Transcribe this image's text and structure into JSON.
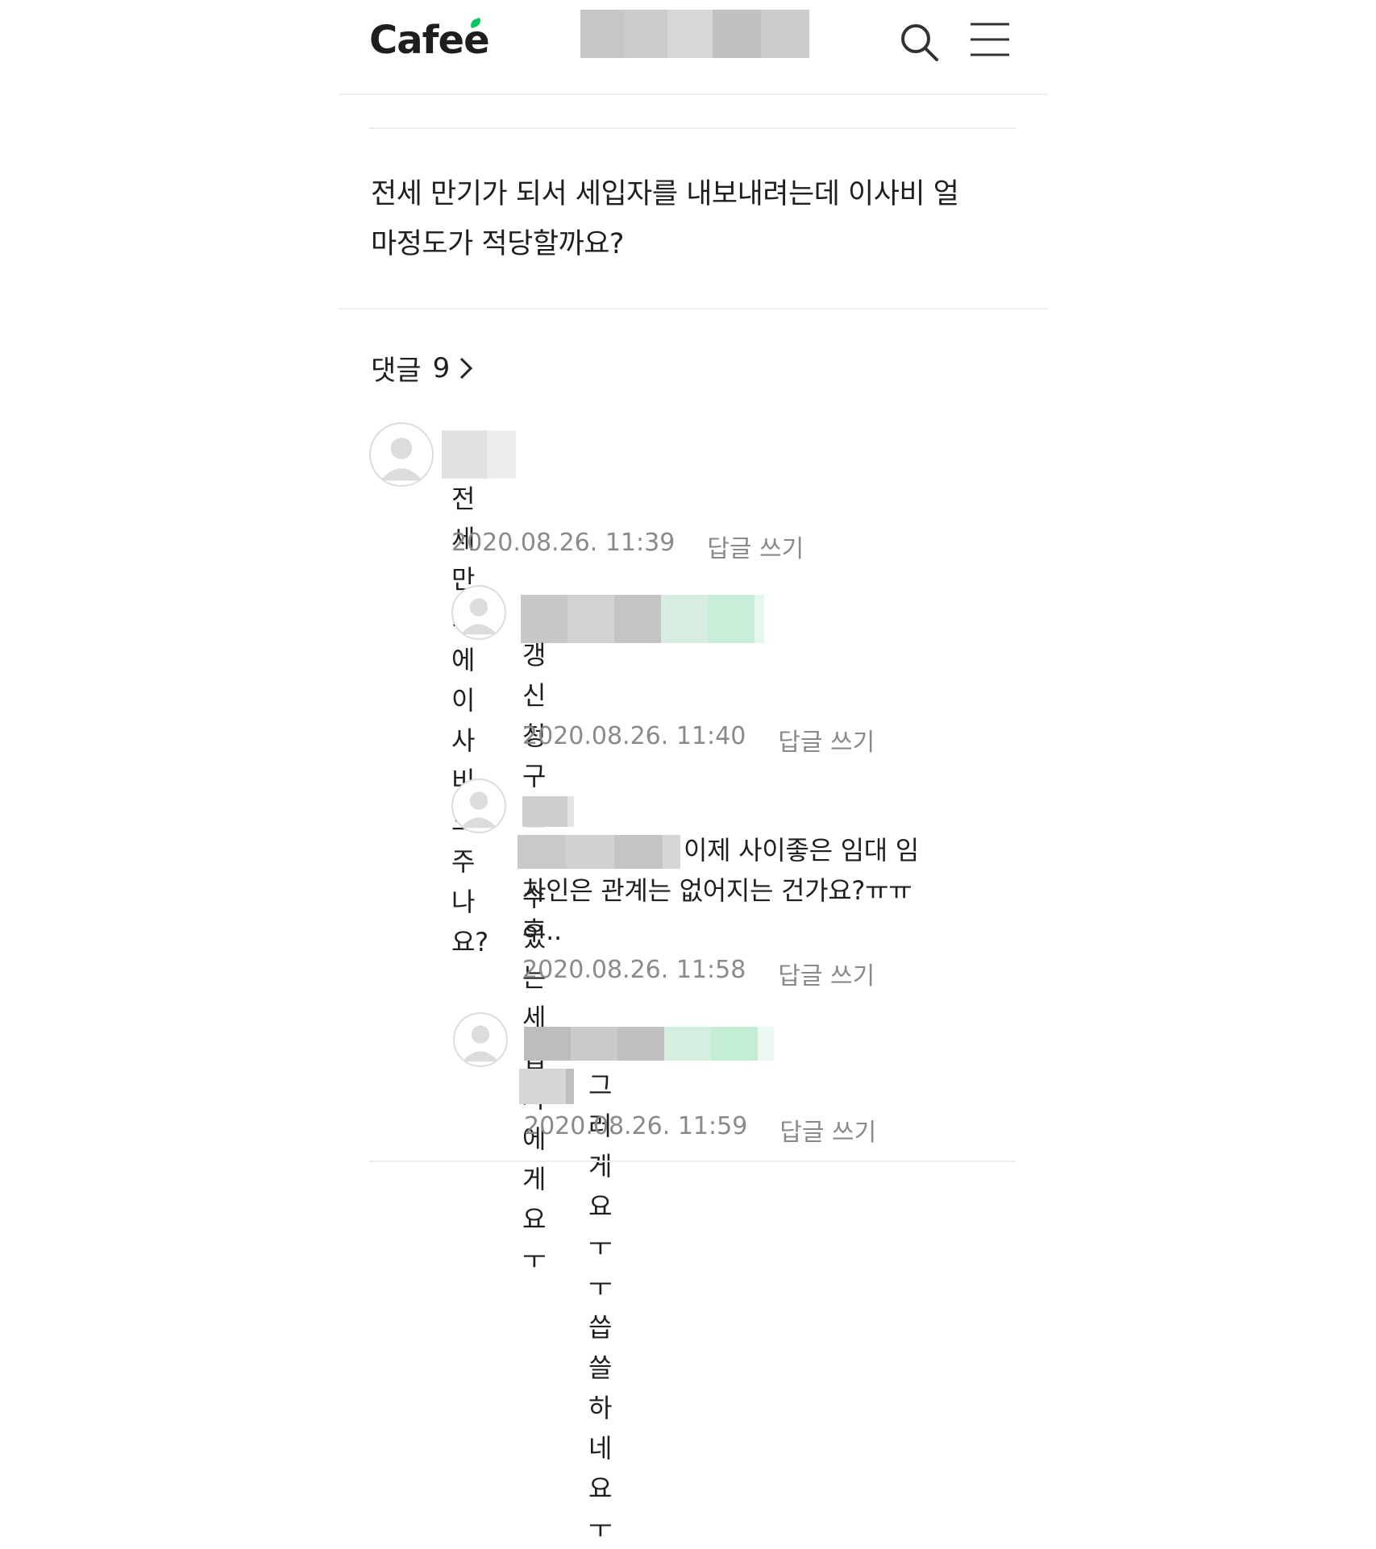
{
  "header": {
    "logo_text": "Cafe",
    "logo_accent": "é",
    "icons": [
      "search-icon",
      "menu-icon"
    ]
  },
  "colors": {
    "brand": "#03c75a",
    "blur_gray_1": "#c4c4c4",
    "blur_gray_2": "#d4d4d4",
    "blur_gray_3": "#bdbdbd",
    "blur_green": "#cdeedd",
    "meta_gray": "#8a8a8a"
  },
  "post": {
    "title_line1": "전세 만기가 되서 세입자를 내보내려는데 이사비 얼",
    "title_line2": "마정도가 적당할까요?"
  },
  "comments_header": {
    "label": "댓글",
    "count": "9"
  },
  "comments": [
    {
      "text": "전세만기에 이사비도 주나요?",
      "date": "2020.08.26. 11:39",
      "reply_label": "답글 쓰기"
    },
    {
      "text_line1": "갱신청구권 쓸 수 있는 세입자에게요",
      "text_line2": "ㅜ",
      "date": "2020.08.26. 11:40",
      "reply_label": "답글 쓰기"
    },
    {
      "text_line1": "이제 사이좋은 임대 임",
      "text_line2": "차인은 관계는 없어지는 건가요?ㅠㅠ",
      "text_line3": "후..",
      "date": "2020.08.26. 11:58",
      "reply_label": "답글 쓰기"
    },
    {
      "text": "그러게요ㅜㅜ씁쓸하네요ㅜ",
      "date": "2020.08.26. 11:59",
      "reply_label": "답글 쓰기"
    }
  ]
}
